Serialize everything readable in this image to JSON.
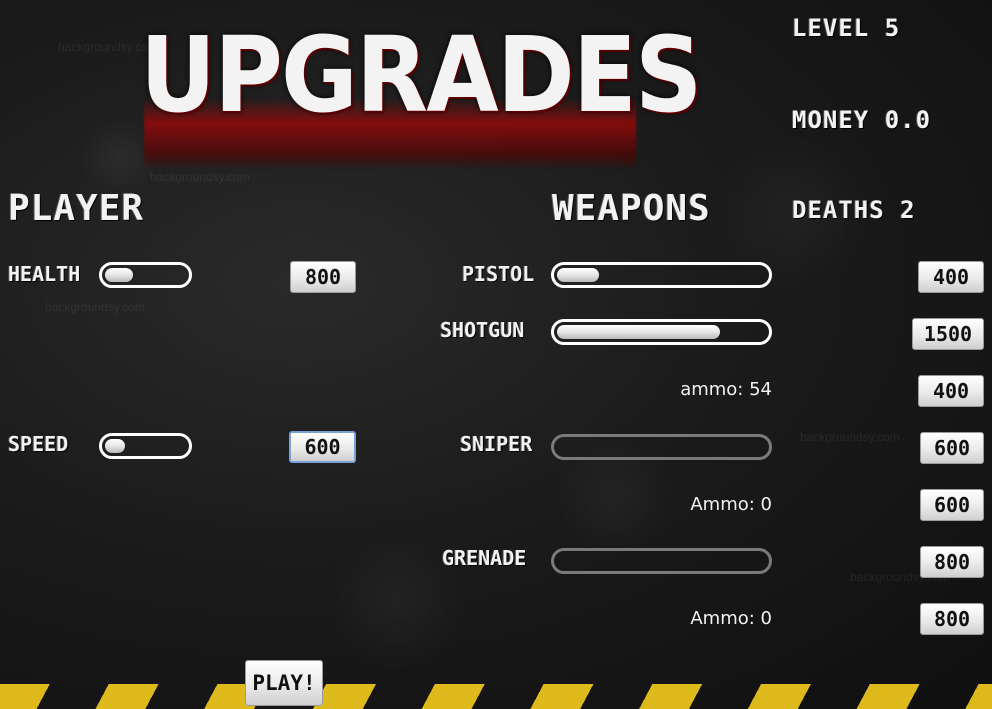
{
  "title": "UPGRADES",
  "stats": {
    "level": "LEVEL 5",
    "money": "MONEY 0.0",
    "deaths": "DEATHS 2"
  },
  "player": {
    "heading": "PLAYER",
    "upgrades": [
      {
        "label": "HEALTH",
        "level": 0.35,
        "cost": "800"
      },
      {
        "label": "SPEED",
        "level": 0.25,
        "cost": "600"
      }
    ]
  },
  "weapons": {
    "heading": "WEAPONS",
    "items": [
      {
        "label": "PISTOL",
        "level": 0.2,
        "cost": "400",
        "enabled": true
      },
      {
        "label": "SHOTGUN",
        "level": 0.78,
        "cost": "1500",
        "enabled": true,
        "ammo_text": "ammo: 54",
        "ammo_cost": "400"
      },
      {
        "label": "SNIPER",
        "level": 0,
        "cost": "600",
        "enabled": false,
        "ammo_text": "Ammo: 0",
        "ammo_cost": "600"
      },
      {
        "label": "GRENADE",
        "level": 0,
        "cost": "800",
        "enabled": false,
        "ammo_text": "Ammo: 0",
        "ammo_cost": "800"
      }
    ]
  },
  "play_button": "PLAY!",
  "watermark": "backgroundsy.com",
  "colors": {
    "hazard_yellow": "#e8c21c",
    "title_blood": "#8c0000",
    "text": "#f2f2f2"
  }
}
